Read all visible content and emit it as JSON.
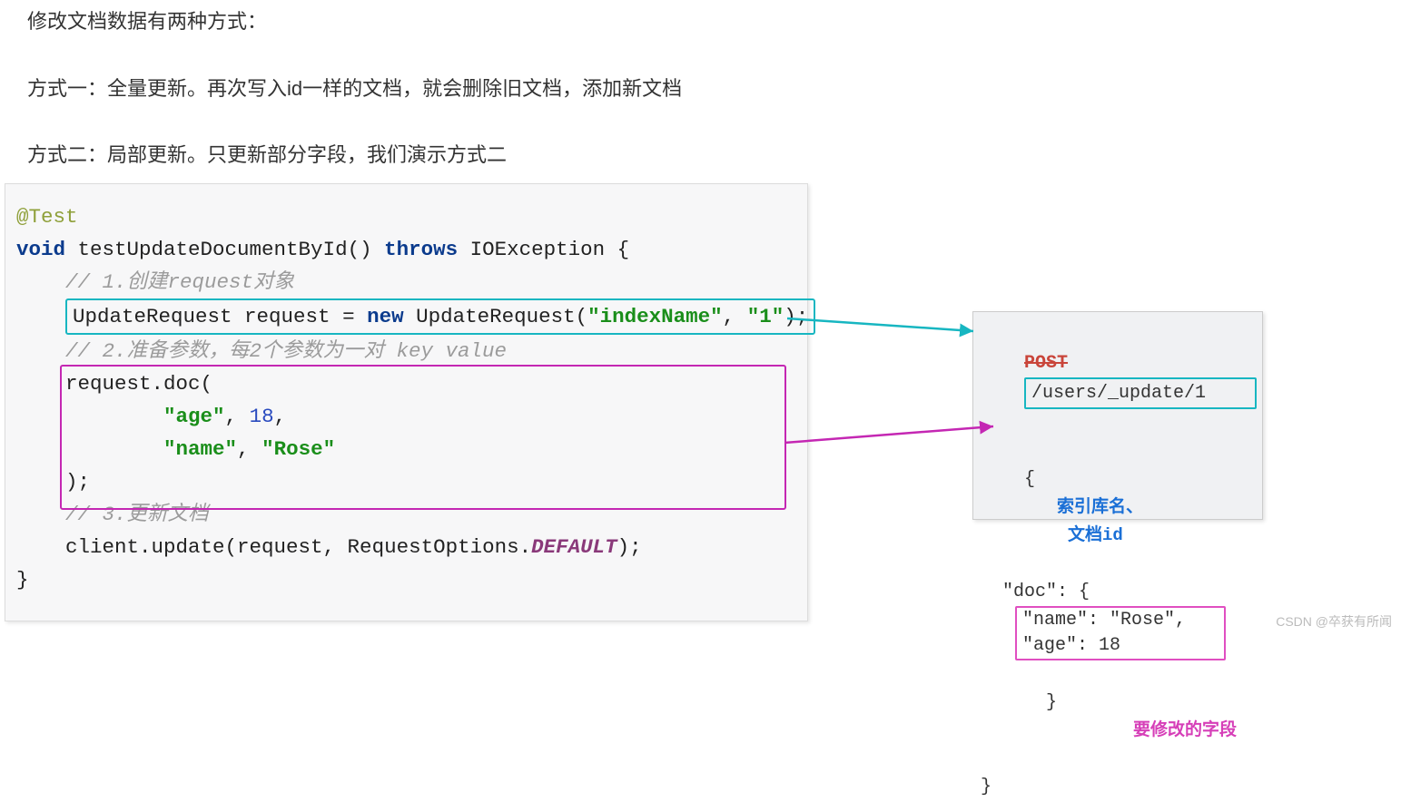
{
  "intro": {
    "line1": "修改文档数据有两种方式：",
    "line2": "方式一：全量更新。再次写入id一样的文档，就会删除旧文档，添加新文档",
    "line3": "方式二：局部更新。只更新部分字段，我们演示方式二"
  },
  "code": {
    "annotation": "@Test",
    "kw_void": "void",
    "method_name": " testUpdateDocumentById() ",
    "kw_throws": "throws",
    "exc": " IOException {",
    "comment1": "    // 1.创建request对象",
    "line_req_1": "    UpdateRequest request = ",
    "kw_new": "new",
    "line_req_2": " UpdateRequest(",
    "str_index": "\"indexName\"",
    "line_req_3": ", ",
    "str_one": "\"1\"",
    "line_req_4": ");",
    "comment2": "    // 2.准备参数，每2个参数为一对 key value",
    "doc_open": "    request.doc(",
    "doc_age_pre": "            ",
    "str_age": "\"age\"",
    "doc_age_mid": ", ",
    "num_18": "18",
    "doc_age_end": ",",
    "doc_name_pre": "            ",
    "str_name": "\"name\"",
    "doc_name_mid": ", ",
    "str_rose": "\"Rose\"",
    "doc_close": "    );",
    "comment3": "    // 3.更新文档",
    "update_1": "    client.update(request, RequestOptions.",
    "const_default": "DEFAULT",
    "update_2": ");",
    "brace_close": "}"
  },
  "rest": {
    "post": "POST",
    "path": "/users/_update/1",
    "open": "{",
    "annot_index": "索引库名、",
    "annot_id": "文档id",
    "doc_open": "  \"doc\": {",
    "name_line": "\"name\": \"Rose\",",
    "age_line": "\"age\": 18",
    "doc_close": "  }",
    "annot_fields": "要修改的字段",
    "close": "}"
  },
  "watermark": "CSDN @卒获有所闻"
}
